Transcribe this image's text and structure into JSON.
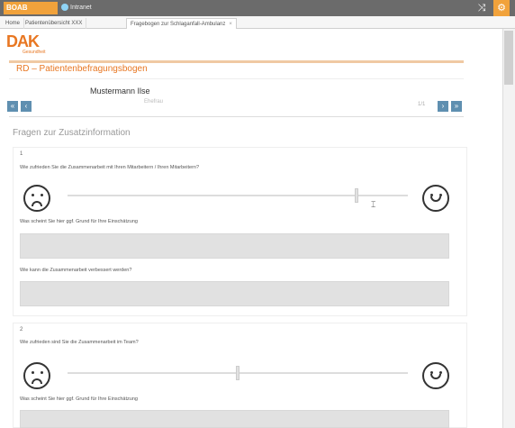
{
  "topbar": {
    "brand": "BOAB",
    "link": "Intranet",
    "share_icon": "share-icon",
    "settings_icon": "gear-icon"
  },
  "tabs": [
    {
      "label": "Home",
      "active": false
    },
    {
      "label": "Patientenübersicht XXX",
      "active": false
    },
    {
      "label": "Fragebogen zur Schlaganfall-Ambulanz",
      "active": true
    }
  ],
  "logo": {
    "big": "DAK",
    "small": "Gesundheit"
  },
  "form": {
    "title": "RD – Patientenbefragungsbogen",
    "patient_name": "Mustermann Ilse",
    "patient_sub": "Ehefrau",
    "page_count": "1/1"
  },
  "section_title": "Fragen zur Zusatzinformation",
  "questions": [
    {
      "number": "1",
      "text": "Wie zufrieden Sie die Zusammenarbeit mit Ihren Mitarbeitern / Ihren Mitarbeitern?",
      "slider_value": 0.85,
      "follow_up_1": "Was scheint Sie hier ggf. Grund für Ihre Einschätzung",
      "follow_up_2": "Wie kann die Zusammenarbeit verbessert werden?"
    },
    {
      "number": "2",
      "text": "Wie zufrieden sind Sie die Zusammenarbeit im Team?",
      "slider_value": 0.5,
      "follow_up_1": "Was scheint Sie hier ggf. Grund für Ihre Einschätzung"
    }
  ],
  "colors": {
    "accent": "#e87722",
    "brand": "#f1a23b",
    "nav": "#5f8fb0"
  }
}
